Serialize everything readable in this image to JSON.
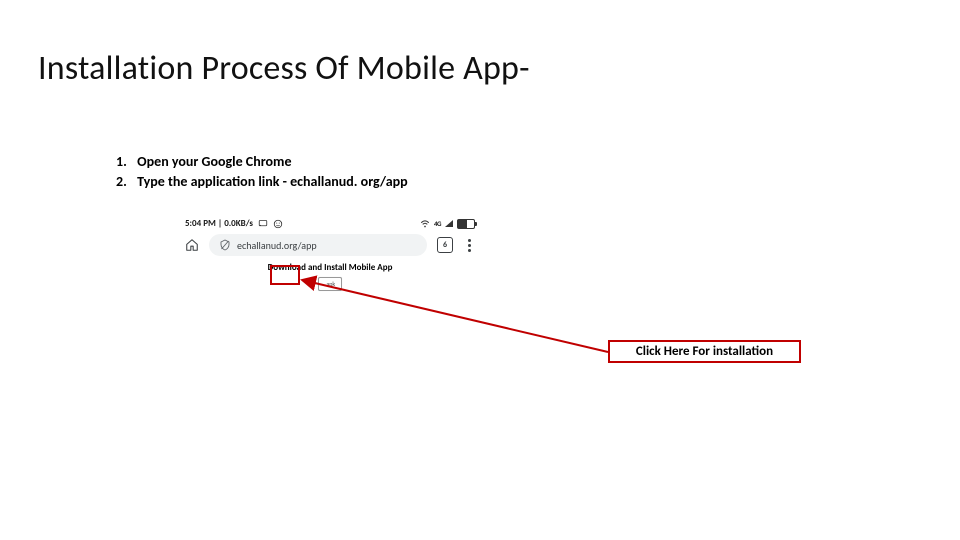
{
  "title": "Installation Process Of Mobile App-",
  "steps": {
    "item1_num": "1.",
    "item1_text": "Open your Google Chrome",
    "item2_num": "2.",
    "item2_prefix": "Type the application link - ",
    "item2_link": "echallanud. org/app"
  },
  "mock": {
    "status_time": "5:04 PM | 0.0KB/s",
    "tab_count": "6",
    "address_url": "echallanud.org/app",
    "page_heading": "Download and Install Mobile App",
    "apk_label": ".apk"
  },
  "callout": {
    "text": "Click Here For installation"
  },
  "colors": {
    "accent_red": "#c00000"
  }
}
